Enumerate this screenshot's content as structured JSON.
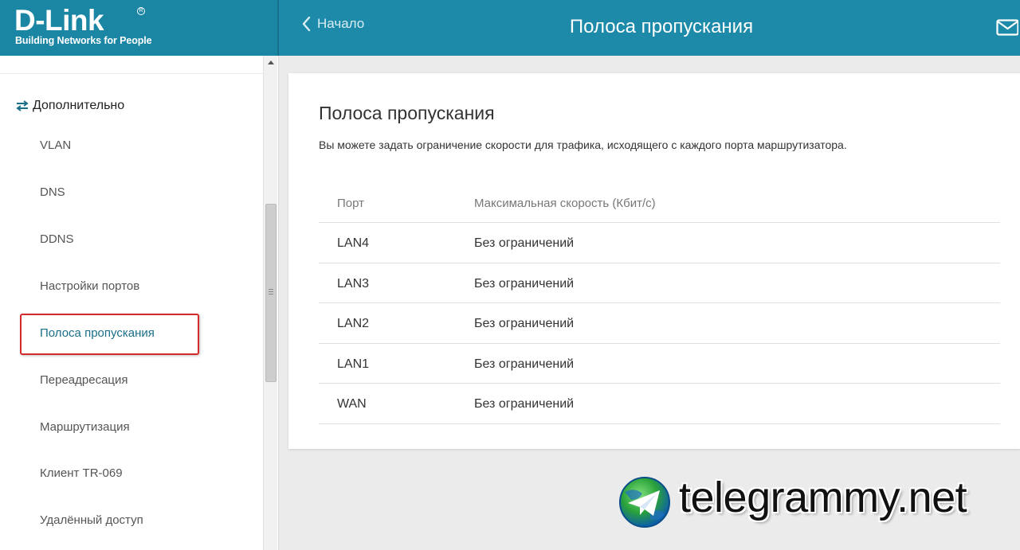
{
  "brand": {
    "logo": "D-Link",
    "tagline": "Building Networks for People"
  },
  "header": {
    "back_label": "Начало",
    "title": "Полоса пропускания"
  },
  "sidebar": {
    "section_label": "Дополнительно",
    "items": [
      {
        "label": "VLAN"
      },
      {
        "label": "DNS"
      },
      {
        "label": "DDNS"
      },
      {
        "label": "Настройки портов"
      },
      {
        "label": "Полоса пропускания",
        "active": true
      },
      {
        "label": "Переадресация"
      },
      {
        "label": "Маршрутизация"
      },
      {
        "label": "Клиент TR-069"
      },
      {
        "label": "Удалённый доступ"
      }
    ]
  },
  "main": {
    "title": "Полоса пропускания",
    "description": "Вы можете задать ограничение скорости для трафика, исходящего с каждого порта маршрутизатора.",
    "table": {
      "columns": [
        "Порт",
        "Максимальная скорость (Кбит/с)"
      ],
      "rows": [
        [
          "LAN4",
          "Без ограничений"
        ],
        [
          "LAN3",
          "Без ограничений"
        ],
        [
          "LAN2",
          "Без ограничений"
        ],
        [
          "LAN1",
          "Без ограничений"
        ],
        [
          "WAN",
          "Без ограничений"
        ]
      ]
    }
  },
  "watermark": {
    "text": "telegrammy.net"
  },
  "colors": {
    "header_bg": "#1c8aa8",
    "highlight_border": "#d42a2a",
    "active_item": "#1b6f88"
  }
}
